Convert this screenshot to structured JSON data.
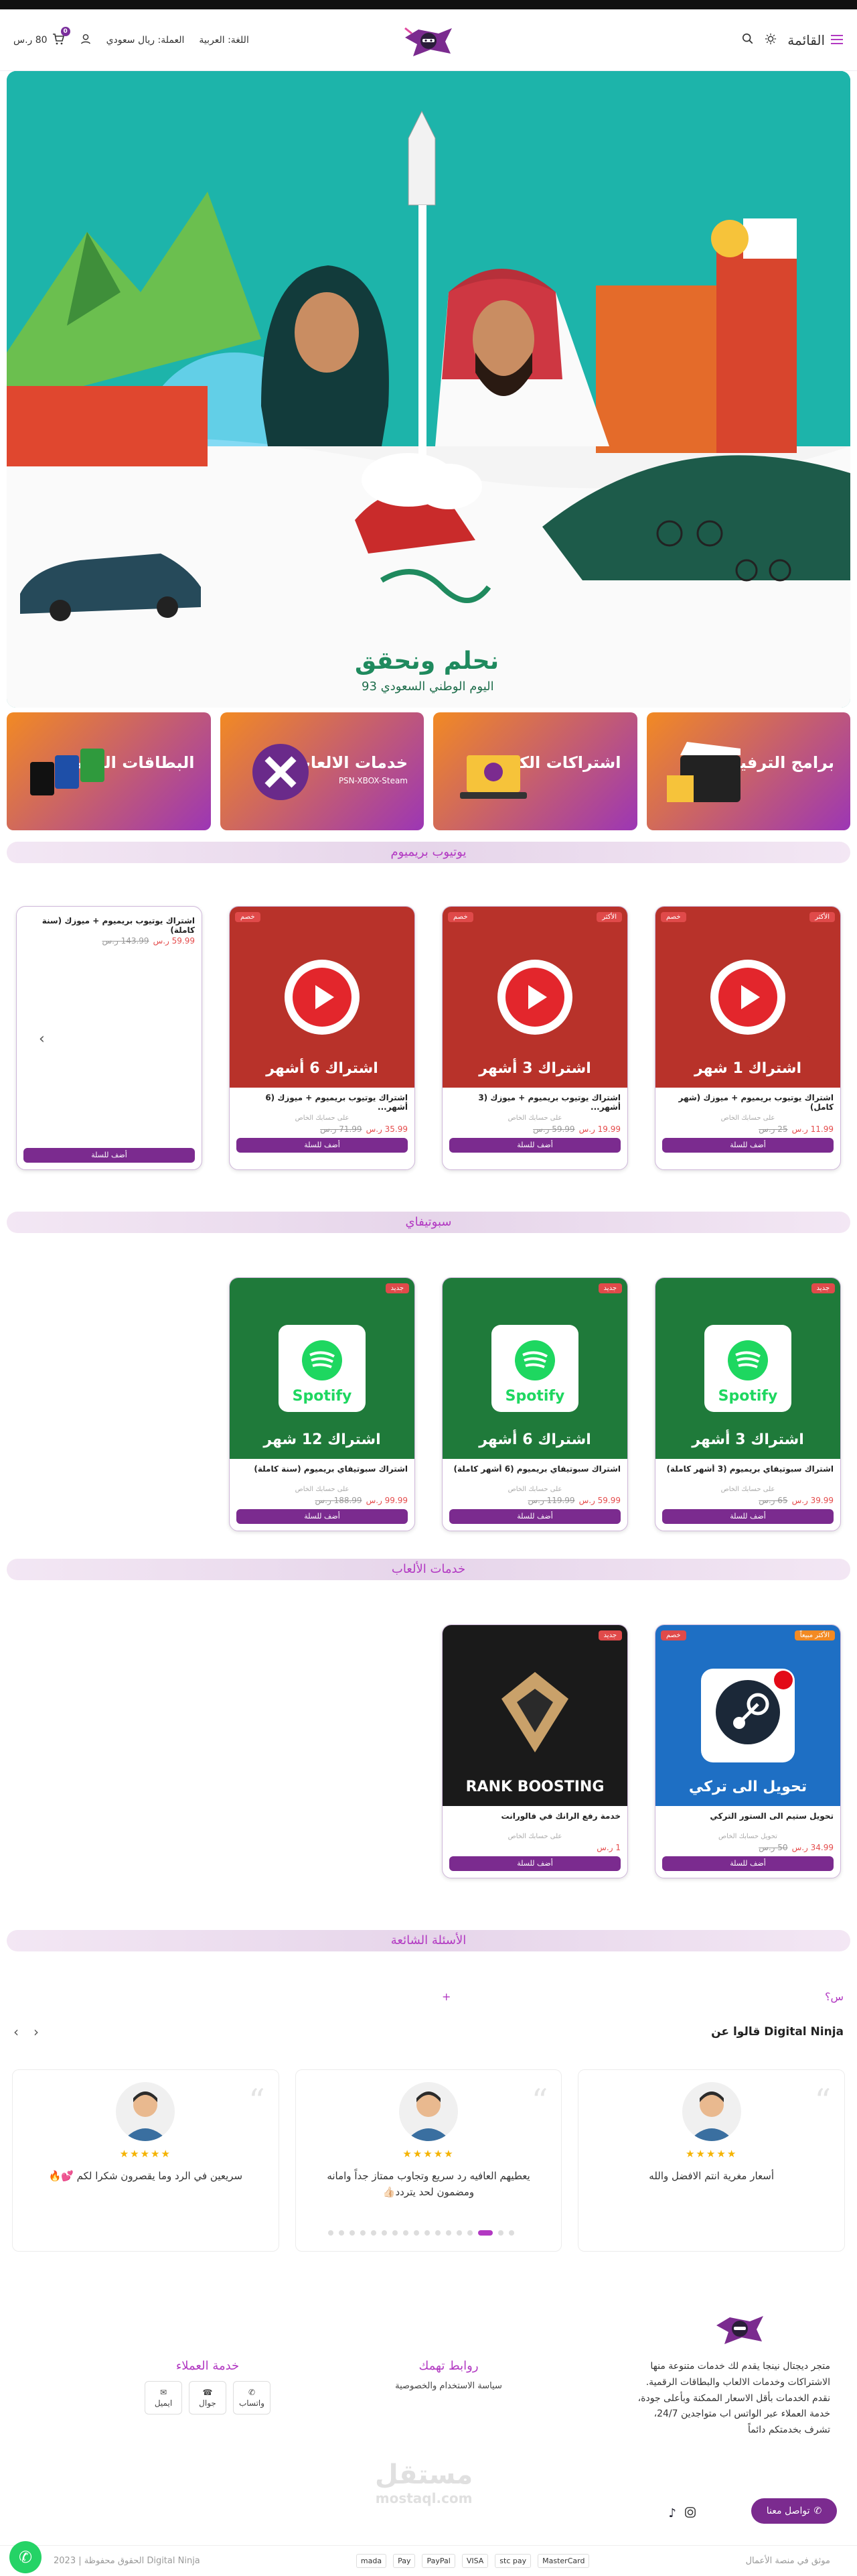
{
  "header": {
    "menu_label": "القائمة",
    "language": "اللغة: العربية",
    "currency": "العملة: ريال سعودي",
    "cart_total": "80 ر.س",
    "cart_count": "0",
    "logo_text": "Digital Ninja"
  },
  "hero": {
    "title": "نحلم ونحقق",
    "subtitle": "اليوم الوطني السعودي 93"
  },
  "categories": [
    {
      "title": "برامج الترفيه",
      "sub": ""
    },
    {
      "title": "اشتراكات الكمبيوتر",
      "sub": ""
    },
    {
      "title": "خدمات الالعاب",
      "sub": "PSN-XBOX-Steam"
    },
    {
      "title": "البطاقات الرقمية",
      "sub": ""
    }
  ],
  "sections": {
    "youtube": "يوتيوب بريميوم",
    "spotify": "سبوتيفاي",
    "games": "خدمات الألعاب",
    "faq": "الأسئلة الشائعة"
  },
  "youtube_products": [
    {
      "title": "اشتراك 1 شهر",
      "name": "اشتراك يوتيوب بريميوم + ميوزك (شهر كامل)",
      "seller": "على حسابك الخاص",
      "price": "11.99 ر.س",
      "old": "25 ر.س",
      "tag": "خصم",
      "tag2": "الأكثر"
    },
    {
      "title": "اشتراك 3 أشهر",
      "name": "اشتراك يوتيوب بريميوم + ميوزك (3 أشهر...",
      "seller": "على حسابك الخاص",
      "price": "19.99 ر.س",
      "old": "59.99 ر.س",
      "tag": "خصم",
      "tag2": "الأكثر"
    },
    {
      "title": "اشتراك 6 أشهر",
      "name": "اشتراك يوتيوب بريميوم + ميوزك (6 أشهر...",
      "seller": "على حسابك الخاص",
      "price": "35.99 ر.س",
      "old": "71.99 ر.س",
      "tag": "خصم",
      "tag2": ""
    },
    {
      "title": "",
      "name": "اشتراك يوتيوب بريميوم + ميوزك (سنة كاملة)",
      "seller": "",
      "price": "59.99 ر.س",
      "old": "143.99 ر.س",
      "tag": "",
      "tag2": ""
    }
  ],
  "spotify_products": [
    {
      "title": "اشتراك 3 أشهر",
      "name": "اشتراك سبوتيفاي بريميوم (3 أشهر كاملة)",
      "seller": "على حسابك الخاص",
      "price": "39.99 ر.س",
      "old": "65 ر.س",
      "tag": "جديد"
    },
    {
      "title": "اشتراك 6 أشهر",
      "name": "اشتراك سبوتيفاي بريميوم (6 أشهر كاملة)",
      "seller": "على حسابك الخاص",
      "price": "59.99 ر.س",
      "old": "119.99 ر.س",
      "tag": "جديد"
    },
    {
      "title": "اشتراك 12 شهر",
      "name": "اشتراك سبوتيفاي بريميوم (سنة كاملة)",
      "seller": "على حسابك الخاص",
      "price": "99.99 ر.س",
      "old": "188.99 ر.س",
      "tag": "جديد"
    }
  ],
  "game_products": [
    {
      "title": "تحويل الى تركي",
      "name": "تحويل ستيم الى الستور التركي",
      "seller": "تحويل حسابك الخاص",
      "price": "34.99 ر.س",
      "old": "50 ر.س",
      "tag": "الأكثر مبيعاً",
      "tag2": "خصم"
    },
    {
      "title": "RANK BOOSTING",
      "name": "خدمة رفع الرانك في فالورانت",
      "seller": "على حسابك الخاص",
      "price": "1 ر.س",
      "old": "",
      "tag": "جديد",
      "tag2": ""
    }
  ],
  "add_to_cart": "أضف للسلة",
  "faq": {
    "question": "س؟",
    "plus": "+"
  },
  "reviews": {
    "title": "قالوا عن Digital Ninja",
    "items": [
      {
        "text": "أسعار مغرية انتم الافضل والله",
        "stars": "★★★★★"
      },
      {
        "text": "يعطيهم العافيه رد سريع وتجاوب ممتاز جداً وامانه ومضمون لحد يتردد👍🏻",
        "stars": "★★★★★"
      },
      {
        "text": "سريعين في الرد وما يقصرون شكرا لكم 💕🔥",
        "stars": "★★★★★"
      }
    ]
  },
  "footer": {
    "about": "متجر ديجتال نينجا يقدم لك خدمات متنوعة منها الاشتراكات وخدمات الالعاب والبطاقات الرقمية. نقدم الخدمات بأقل الاسعار الممكنة وبأعلى جودة، خدمة العملاء عبر الواتس اب متواجدين 24/7، تشرف بخدمتكم دائماً",
    "links_title": "روابط تهمك",
    "link_privacy": "سياسة الاستخدام والخصوصية",
    "cs_title": "خدمة العملاء",
    "cs_whatsapp": "واتساب",
    "cs_phone": "جوال",
    "cs_email": "ايميل",
    "contact_btn": "تواصل معنا",
    "copyright": "الحقوق محفوظة | 2023 Digital Ninja",
    "platform": "موثق في منصة الأعمال",
    "watermark": "مستقل",
    "watermark_en": "mostaql.com",
    "payments": [
      "mada",
      "Pay",
      "PayPal",
      "VISA",
      "stc pay",
      "MasterCard"
    ]
  },
  "colors": {
    "brand": "#7b2b8f",
    "accent": "#b239c2",
    "price": "#e54d4d",
    "youtube_bg": "#b8322a",
    "spotify_bg": "#1f7a3a"
  }
}
